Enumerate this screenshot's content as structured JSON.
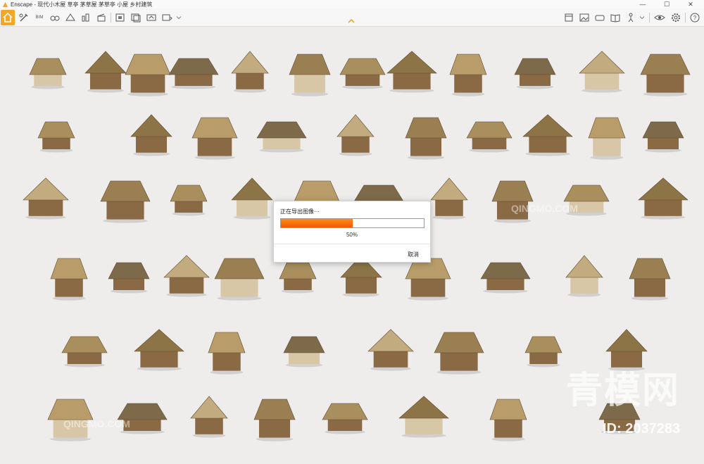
{
  "window": {
    "title": "Enscape - 现代小木屋 草亭 茅草屋 茅草亭 小屋 乡村建筑",
    "controls": {
      "minimize": "—",
      "maximize": "☐",
      "close": "✕"
    }
  },
  "toolbar": {
    "left_icons": [
      "home-icon",
      "draw-icon",
      "bim-icon",
      "asset-library-icon",
      "materials-icon",
      "atmosphere-icon",
      "clapper-icon",
      "screenshot-icon",
      "batch-render-icon",
      "video-icon",
      "export-icon"
    ],
    "right_icons": [
      "views-icon",
      "image-icon",
      "panorama-icon",
      "book-icon",
      "walk-icon",
      "visual-settings-icon",
      "eye-icon",
      "gear-icon",
      "help-icon"
    ],
    "left_labels": {
      "bim": "BIM"
    }
  },
  "dialog": {
    "title": "正在导出图像···",
    "progress": 0.5,
    "progress_label": "50%",
    "cancel_label": "取消"
  },
  "watermark": {
    "brand": "青模网",
    "id": "ID: 2037283",
    "latin": "QINGMO.COM"
  },
  "colors": {
    "accent": "#f5a623",
    "progress": "#f26b00",
    "thatch": "#a98f5e",
    "wood": "#8a6a44"
  }
}
